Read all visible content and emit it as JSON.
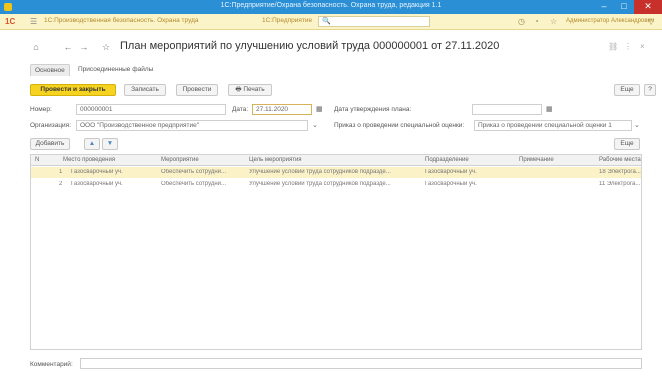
{
  "window": {
    "title": "1С:Предприятие/Охрана безопасность. Охрана труда, редакция 1.1"
  },
  "sectionbar": {
    "logo": "1С",
    "tabs": [
      "1С:Производственная безопасность. Охрана труда",
      "1С:Предприятие"
    ],
    "user": "Администратор Александрович"
  },
  "document": {
    "title": "План мероприятий по улучшению условий труда 000000001 от 27.11.2020"
  },
  "tabs": [
    "Основное",
    "Присоединенные файлы"
  ],
  "toolbar": {
    "post_close": "Провести и закрыть",
    "save": "Записать",
    "post": "Провести",
    "print": "Печать",
    "more": "Еще",
    "help": "?"
  },
  "form": {
    "number_label": "Номер:",
    "number_value": "000000001",
    "date_label": "Дата:",
    "date_value": "27.11.2020",
    "approval_date_label": "Дата утверждения плана:",
    "approval_date_value": "",
    "org_label": "Организация:",
    "org_value": "ООО \"Производственное предприятие\"",
    "order_label": "Приказ о проведении специальной оценки:",
    "order_value": "Приказ о проведении специальной оценки 1"
  },
  "table_toolbar": {
    "add": "Добавить",
    "up": "▲",
    "down": "▼",
    "more": "Еще"
  },
  "table": {
    "columns": [
      "N",
      "Место проведения",
      "Мероприятие",
      "Цель мероприятия",
      "Подразделение",
      "Примечание",
      "Рабочие места"
    ],
    "rows": [
      {
        "n": "1",
        "place": "Газосварочный уч.",
        "measure": "Обеспечить сотрудни...",
        "goal": "Улучшение условий труда сотрудников подразде...",
        "dept": "Газосварочный уч.",
        "note": "",
        "workplaces": "18 Электрога..."
      },
      {
        "n": "2",
        "place": "Газосварочный уч.",
        "measure": "Обеспечить сотрудни...",
        "goal": "Улучшение условий труда сотрудников подразде...",
        "dept": "Газосварочный уч.",
        "note": "",
        "workplaces": "11 Электрога..."
      }
    ]
  },
  "footer": {
    "comment_label": "Комментарий:",
    "comment_value": ""
  },
  "colors": {
    "titlebar": "#2b8fd6",
    "sectionbar": "#fbf4c8",
    "primary_button": "#f5d320",
    "selected_row": "#fbf2c8"
  }
}
